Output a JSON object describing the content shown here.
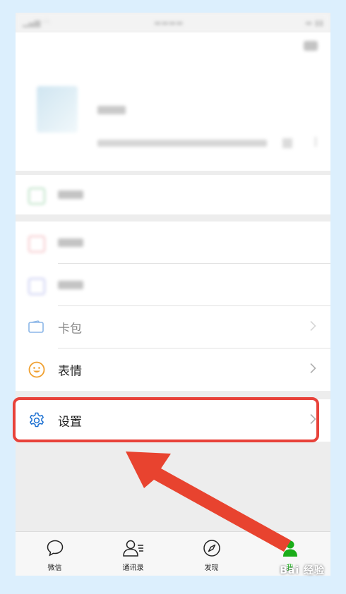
{
  "list": {
    "card_label": "卡包",
    "sticker_label": "表情",
    "settings_label": "设置"
  },
  "tabbar": {
    "chats": "微信",
    "contacts": "通讯录",
    "discover": "发现",
    "me": "我"
  },
  "watermark": "Bai 经验",
  "colors": {
    "highlight": "#e8423a",
    "arrow": "#e8432f",
    "settings_icon": "#1a6fd1",
    "sticker_icon": "#f0a030",
    "me_active": "#1aad19"
  }
}
